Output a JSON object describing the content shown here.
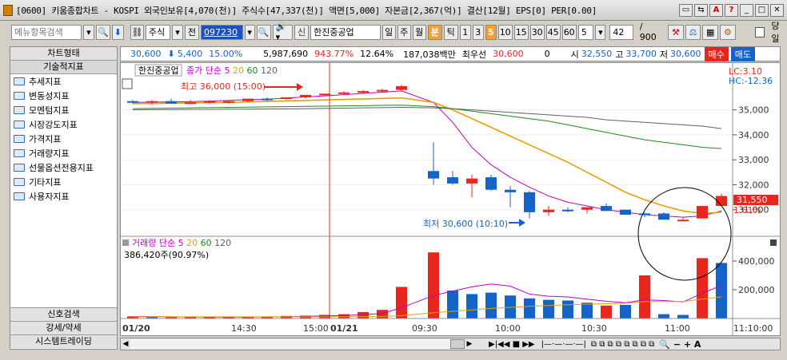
{
  "window": {
    "title": "[0600] 키움종합차트 - KOSPI 외국인보유[4,070(천)] 주식수[47,337(천)] 액면[5,000] 자본금[2,367(억)] 결산[12월] EPS[0] PER[0.00]",
    "buttons": [
      "▭",
      "⇆",
      "A",
      "?",
      "_",
      "□",
      "✕"
    ]
  },
  "toolbar": {
    "menu_search_placeholder": "메뉴항목검색",
    "type": "주식",
    "prev": "전",
    "code": "097230",
    "stock_name_prefix": "신",
    "stock_name": "한진중공업",
    "periods": [
      "일",
      "주",
      "월"
    ],
    "minute": "분",
    "tick": "틱",
    "intervals": [
      "1",
      "3",
      "5",
      "10",
      "15",
      "30",
      "45",
      "60"
    ],
    "selected_interval": "5",
    "interval_select": "5",
    "count": "42",
    "count_total": "/ 900",
    "today_label": "당일"
  },
  "sidebar": {
    "header_top": "차트형태",
    "header_tech": "기술적지표",
    "items": [
      "추세지표",
      "변동성지표",
      "모멘텀지표",
      "시장강도지표",
      "가격지표",
      "거래량지표",
      "선물옵션전용지표",
      "기타지표",
      "사용자지표"
    ],
    "bottom": [
      "신호검색",
      "강세/약세",
      "시스템트레이딩"
    ]
  },
  "infobar": {
    "price": "30,600",
    "change": "5,400",
    "change_pct": "15.00%",
    "volume": "5,987,690",
    "vol_ratio": "943.77%",
    "turnover": "12.64%",
    "amount": "187,038백만",
    "best_bid_label": "최우선",
    "best_bid": "30,600",
    "zero": "0",
    "open_label": "시",
    "open": "32,550",
    "high_label": "고",
    "high": "33,700",
    "low_label": "저",
    "low": "30,600",
    "buy": "매수",
    "sell": "매도"
  },
  "colors": {
    "up": "#e8261c",
    "down": "#1464c8",
    "ma5": "#c000c0",
    "ma20": "#e8a000",
    "ma60": "#1a8a1a",
    "ma120": "#606060",
    "accent_orange": "#f0a030"
  },
  "price_panel": {
    "stock_tag": "한진중공업",
    "legend_prefix": "종가 단순",
    "legend_ma": [
      "5",
      "20",
      "60",
      "120"
    ],
    "high_note": "최고 36,000 (15:00)",
    "low_note": "최저 30,600 (10:10)",
    "lc_hc": [
      "LC:3.10",
      "HC:-12.36"
    ],
    "yticks": [
      "35,000",
      "34,000",
      "33,000",
      "32,000",
      "31,000"
    ],
    "current_price": "31,550",
    "current_pct": "1.61%"
  },
  "volume_panel": {
    "legend_prefix": "거래량 단순",
    "legend_ma": [
      "5",
      "20",
      "60",
      "120"
    ],
    "note": "386,420주(90.97%)",
    "yticks": [
      "400,000",
      "200,000"
    ]
  },
  "xaxis": {
    "labels": [
      "01/20",
      "14:30",
      "15:00",
      "01/21",
      "09:30",
      "10:00",
      "10:30",
      "11:00",
      "11:10:00"
    ]
  },
  "chart_data": {
    "type": "candlestick",
    "price_range": [
      30000,
      36300
    ],
    "candles": [
      [
        35350,
        35400,
        35250,
        35300
      ],
      [
        35300,
        35400,
        35200,
        35350
      ],
      [
        35350,
        35450,
        35250,
        35250
      ],
      [
        35300,
        35400,
        35250,
        35300
      ],
      [
        35300,
        35400,
        35250,
        35350
      ],
      [
        35350,
        35400,
        35250,
        35350
      ],
      [
        35350,
        35450,
        35300,
        35450
      ],
      [
        35450,
        35500,
        35350,
        35400
      ],
      [
        35450,
        35500,
        35400,
        35500
      ],
      [
        35500,
        35600,
        35450,
        35600
      ],
      [
        35600,
        35650,
        35550,
        35650
      ],
      [
        35650,
        35750,
        35600,
        35700
      ],
      [
        35700,
        35800,
        35650,
        35750
      ],
      [
        35750,
        35850,
        35700,
        35800
      ],
      [
        35800,
        36000,
        35750,
        35950
      ],
      [
        32550,
        33700,
        32000,
        32250
      ],
      [
        32300,
        32550,
        32000,
        32050
      ],
      [
        32050,
        32400,
        31500,
        32250
      ],
      [
        32300,
        32400,
        31750,
        31800
      ],
      [
        31800,
        31950,
        31100,
        31700
      ],
      [
        31700,
        31750,
        30650,
        30900
      ],
      [
        30900,
        31150,
        30750,
        31000
      ],
      [
        31000,
        31100,
        30900,
        30950
      ],
      [
        31000,
        31100,
        30850,
        31100
      ],
      [
        31150,
        31250,
        30950,
        30950
      ],
      [
        31000,
        31000,
        30800,
        30800
      ],
      [
        30850,
        30900,
        30700,
        30800
      ],
      [
        30850,
        30900,
        30600,
        30600
      ],
      [
        30600,
        30700,
        30600,
        30600
      ],
      [
        30650,
        31100,
        30650,
        31150
      ],
      [
        31150,
        31650,
        31150,
        31550
      ]
    ],
    "ma5": [
      35300,
      35310,
      35320,
      35330,
      35350,
      35380,
      35410,
      35430,
      35470,
      35520,
      35560,
      35610,
      35660,
      35710,
      35760,
      35300,
      34500,
      33500,
      32800,
      32300,
      31900,
      31550,
      31300,
      31150,
      31000,
      30900,
      30800,
      30750,
      30700,
      30750,
      30950
    ],
    "ma20": [
      35250,
      35260,
      35270,
      35280,
      35290,
      35300,
      35320,
      35340,
      35360,
      35380,
      35400,
      35420,
      35440,
      35460,
      35480,
      35300,
      35000,
      34650,
      34300,
      33950,
      33600,
      33250,
      32900,
      32500,
      32100,
      31700,
      31400,
      31150,
      30950,
      30850,
      30900
    ],
    "ma60": [
      35050,
      35060,
      35070,
      35080,
      35090,
      35100,
      35110,
      35120,
      35130,
      35140,
      35150,
      35160,
      35170,
      35180,
      35190,
      35130,
      35050,
      34950,
      34850,
      34750,
      34650,
      34550,
      34400,
      34250,
      34100,
      33950,
      33800,
      33700,
      33600,
      33500,
      33450
    ],
    "ma120": [
      35000,
      35010,
      35010,
      35020,
      35020,
      35030,
      35030,
      35040,
      35040,
      35050,
      35060,
      35070,
      35080,
      35090,
      35100,
      35080,
      35050,
      35000,
      34950,
      34900,
      34850,
      34800,
      34750,
      34700,
      34600,
      34550,
      34500,
      34450,
      34400,
      34350,
      34250
    ],
    "volume": [
      15000,
      12000,
      10000,
      9000,
      9000,
      10000,
      12000,
      14000,
      18000,
      20000,
      25000,
      30000,
      45000,
      60000,
      220000,
      460000,
      195000,
      170000,
      180000,
      160000,
      140000,
      130000,
      125000,
      110000,
      90000,
      95000,
      300000,
      30000,
      25000,
      420000,
      386420
    ],
    "volume_up": [
      true,
      false,
      true,
      true,
      true,
      true,
      true,
      true,
      true,
      true,
      true,
      true,
      true,
      true,
      true,
      true,
      false,
      false,
      false,
      false,
      false,
      false,
      false,
      false,
      true,
      false,
      true,
      false,
      false,
      true,
      false
    ],
    "volume_ma5": [
      14000,
      13000,
      12000,
      11000,
      10000,
      10000,
      10500,
      11000,
      12500,
      14500,
      17500,
      21000,
      27000,
      35000,
      75000,
      160000,
      190000,
      220000,
      240000,
      225000,
      170000,
      155000,
      150000,
      135000,
      120000,
      110000,
      130000,
      125000,
      115000,
      175000,
      230000
    ],
    "volume_ma20": [
      12000,
      12000,
      12000,
      12000,
      12000,
      12000,
      12000,
      12000,
      12000,
      12000,
      12000,
      12500,
      13000,
      14000,
      20000,
      40000,
      50000,
      60000,
      70000,
      78000,
      85000,
      90000,
      96000,
      100000,
      103000,
      106000,
      118000,
      118000,
      118000,
      135000,
      150000
    ],
    "volume_max": 500000
  }
}
